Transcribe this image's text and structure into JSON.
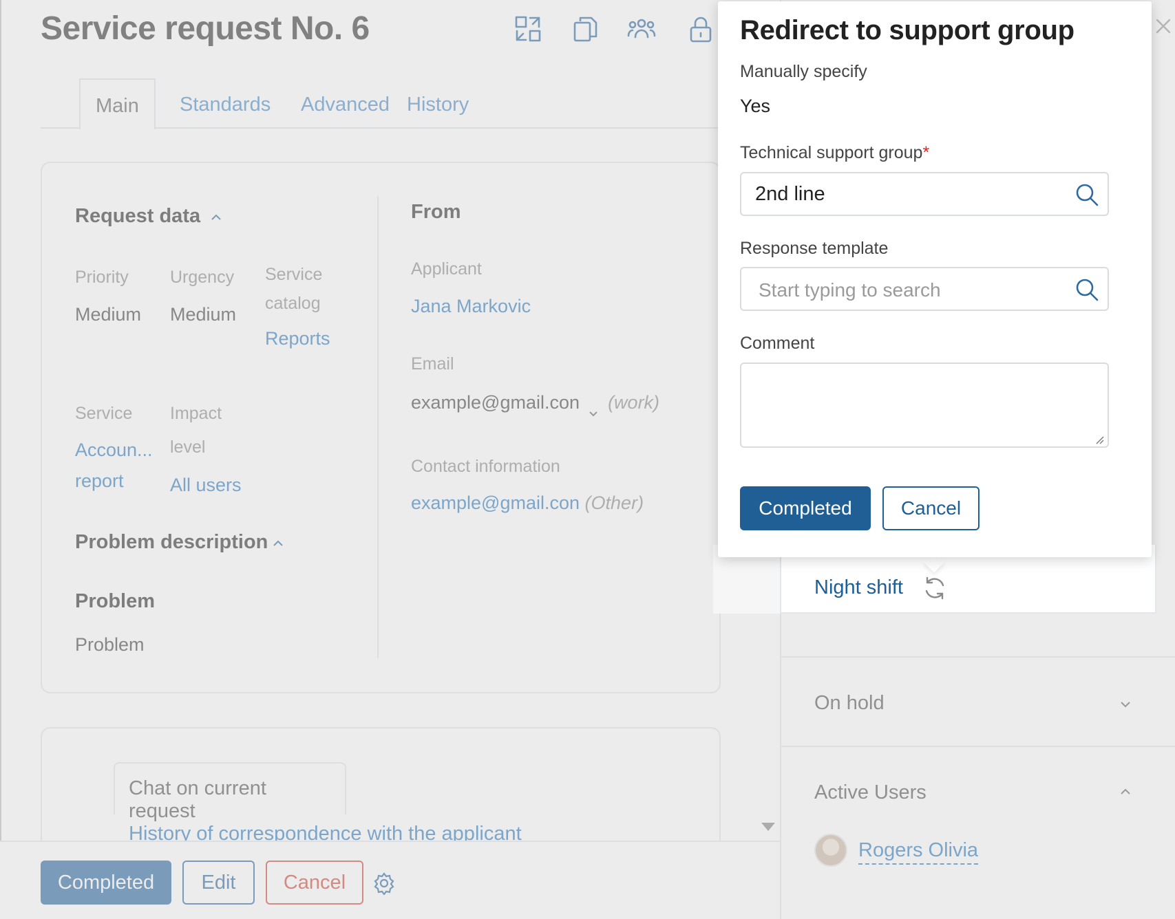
{
  "page": {
    "title": "Service request No. 6"
  },
  "header_icons": [
    "fullscreen-exit-icon",
    "copy-icon",
    "group-icon",
    "lock-icon"
  ],
  "tabs": [
    {
      "label": "Main",
      "active": true
    },
    {
      "label": "Standards",
      "active": false
    },
    {
      "label": "Advanced",
      "active": false
    },
    {
      "label": "History",
      "active": false
    }
  ],
  "request_data": {
    "heading": "Request data",
    "priority_label": "Priority",
    "priority_value": "Medium",
    "urgency_label": "Urgency",
    "urgency_value": "Medium",
    "service_catalog_label_1": "Service",
    "service_catalog_label_2": "catalog",
    "service_catalog_value": "Reports",
    "service_label": "Service",
    "service_value_1": "Accoun...",
    "service_value_2": "report",
    "impact_label_1": "Impact",
    "impact_label_2": "level",
    "impact_value": "All users"
  },
  "from": {
    "heading": "From",
    "applicant_label": "Applicant",
    "applicant_value": "Jana Markovic",
    "email_label": "Email",
    "email_value": "example@gmail.con",
    "email_type": "(work)",
    "contact_label": "Contact information",
    "contact_value": "example@gmail.con",
    "contact_type": "(Other)"
  },
  "problem": {
    "heading": "Problem description",
    "subheading": "Problem",
    "text": "Problem"
  },
  "chat": {
    "tab_label": "Chat on current request",
    "history_link": "History of correspondence with the applicant"
  },
  "footer": {
    "completed_label": "Completed",
    "edit_label": "Edit",
    "cancel_label": "Cancel"
  },
  "right_panel": {
    "night_shift_link": "Night shift",
    "on_hold_label": "On hold",
    "active_users_label": "Active Users",
    "user_name": "Rogers Olivia"
  },
  "popup": {
    "title": "Redirect to support group",
    "manual_label": "Manually specify",
    "manual_value": "Yes",
    "group_label": "Technical support group",
    "required_mark": "*",
    "group_value": "2nd line",
    "template_label": "Response template",
    "template_placeholder": "Start typing to search",
    "comment_label": "Comment",
    "comment_value": "",
    "completed_label": "Completed",
    "cancel_label": "Cancel"
  },
  "colors": {
    "accent": "#2c6aa0",
    "link": "#2f7cc2",
    "danger": "#d14a3b",
    "required": "#d62b2b"
  }
}
